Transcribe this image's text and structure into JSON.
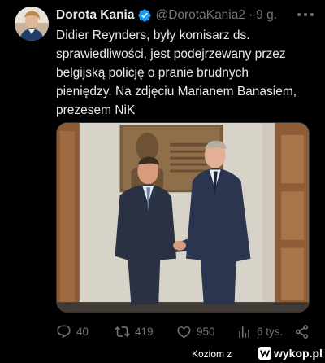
{
  "tweet": {
    "author_name": "Dorota Kania",
    "handle": "@DorotaKania2",
    "separator": "·",
    "time": "9 g.",
    "text_lines": [
      "Didier Reynders, były komisarz ds.",
      "sprawiedliwości, jest podejrzewany przez",
      "belgijską policję o pranie brudnych",
      "pieniędzy. Na zdjęciu Marianem Banasiem,",
      "prezesem NiK"
    ],
    "verified_color": "#1d9bf0"
  },
  "stats": {
    "replies": "40",
    "retweets": "419",
    "likes": "950",
    "views": "6 tys."
  },
  "footer": {
    "uploader": "Koziom z",
    "site": "wykop.pl"
  },
  "icons": {
    "reply": "reply-icon",
    "retweet": "retweet-icon",
    "like": "heart-icon",
    "views": "views-icon",
    "share": "share-icon",
    "more": "more-icon",
    "verified": "verified-badge-icon"
  }
}
